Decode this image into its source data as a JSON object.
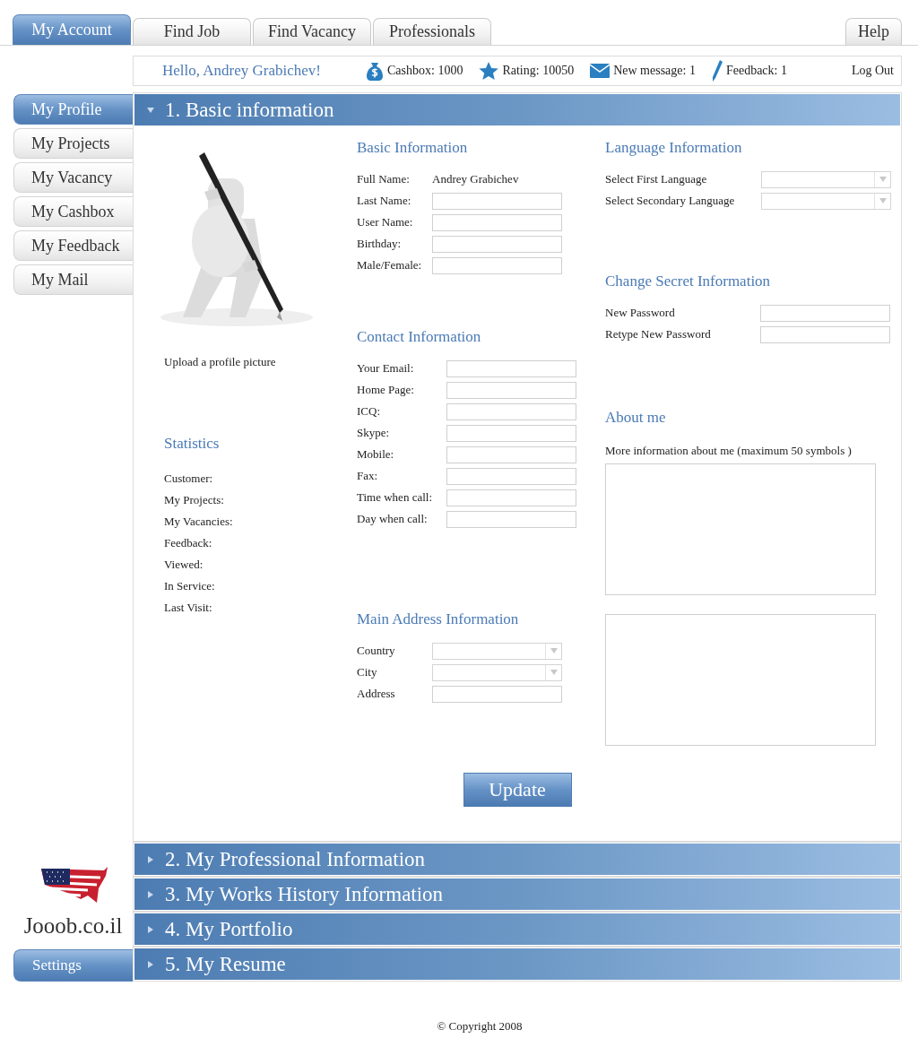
{
  "top_tabs": [
    {
      "label": "My Account",
      "selected": true
    },
    {
      "label": "Find Job",
      "selected": false
    },
    {
      "label": "Find Vacancy",
      "selected": false
    },
    {
      "label": "Professionals",
      "selected": false
    }
  ],
  "help_tab": {
    "label": "Help",
    "selected": false
  },
  "info_bar": {
    "greeting": "Hello, Andrey Grabichev!",
    "stats": [
      {
        "kind": "cashbox",
        "text": "Cashbox: 1000"
      },
      {
        "kind": "rating",
        "text": "Rating: 10050"
      },
      {
        "kind": "message",
        "text": "New message: 1"
      },
      {
        "kind": "feedback",
        "text": "Feedback: 1"
      }
    ],
    "logout": "Log Out"
  },
  "side_nav": [
    {
      "label": "My Profile",
      "selected": true
    },
    {
      "label": "My Projects",
      "selected": false
    },
    {
      "label": "My Vacancy",
      "selected": false
    },
    {
      "label": "My Cashbox",
      "selected": false
    },
    {
      "label": "My Feedback",
      "selected": false
    },
    {
      "label": "My Mail",
      "selected": false
    }
  ],
  "logo": {
    "text": "Jooob.co.il"
  },
  "settings_button": "Settings",
  "sections": [
    {
      "title": "1. Basic information",
      "expanded": true
    },
    {
      "title": "2. My Professional Information",
      "expanded": false
    },
    {
      "title": "3. My Works History Information",
      "expanded": false
    },
    {
      "title": "4. My Portfolio",
      "expanded": false
    },
    {
      "title": "5. My Resume",
      "expanded": false
    }
  ],
  "profile": {
    "upload_label": "Upload a profile picture",
    "statistics": {
      "title": "Statistics",
      "items": [
        "Customer:",
        "My Projects:",
        "My Vacancies:",
        "Feedback:",
        "Viewed:",
        "In Service:",
        "Last Visit:"
      ]
    }
  },
  "basic_info": {
    "title": "Basic Information",
    "fields": [
      {
        "label": "Full Name:",
        "kind": "text",
        "value": "Andrey Grabichev"
      },
      {
        "label": "Last Name:",
        "kind": "input"
      },
      {
        "label": "User Name:",
        "kind": "input"
      },
      {
        "label": "Birthday:",
        "kind": "input"
      },
      {
        "label": "Male/Female:",
        "kind": "input"
      }
    ]
  },
  "contact_info": {
    "title": "Contact Information",
    "fields": [
      {
        "label": "Your Email:",
        "kind": "input"
      },
      {
        "label": "Home Page:",
        "kind": "input"
      },
      {
        "label": "ICQ:",
        "kind": "input"
      },
      {
        "label": "Skype:",
        "kind": "input"
      },
      {
        "label": "Mobile:",
        "kind": "input"
      },
      {
        "label": "Fax:",
        "kind": "input"
      },
      {
        "label": "Time when call:",
        "kind": "input"
      },
      {
        "label": "Day when call:",
        "kind": "input"
      }
    ]
  },
  "address_info": {
    "title": "Main Address Information",
    "fields": [
      {
        "label": "Country",
        "kind": "select"
      },
      {
        "label": "City",
        "kind": "select"
      },
      {
        "label": "Address",
        "kind": "input"
      }
    ]
  },
  "language_info": {
    "title": "Language Information",
    "fields": [
      {
        "label": "Select First Language",
        "kind": "select"
      },
      {
        "label": "Select Secondary Language",
        "kind": "select"
      }
    ]
  },
  "secret_info": {
    "title": "Change Secret Information",
    "fields": [
      {
        "label": "New Password",
        "kind": "input"
      },
      {
        "label": "Retype New Password",
        "kind": "input"
      }
    ]
  },
  "about_me": {
    "title": "About me",
    "note": "More information about me (maximum 50 symbols )"
  },
  "update_button": "Update",
  "footer": "© Copyright 2008"
}
